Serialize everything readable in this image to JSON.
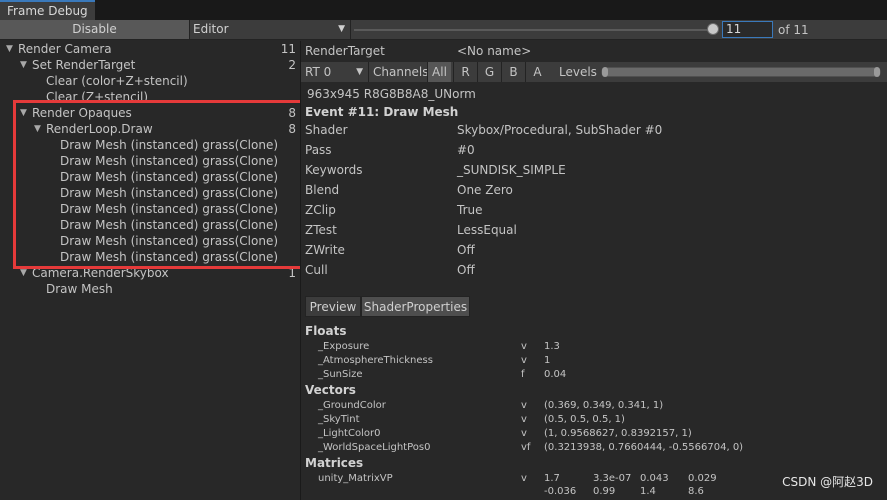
{
  "window": {
    "tab_title": "Frame Debug"
  },
  "toolbar": {
    "disable_label": "Disable",
    "target_value": "Editor",
    "event_index": "11",
    "event_total": "of 11"
  },
  "tree": [
    {
      "label": "Render Camera",
      "count": "11",
      "level": 0,
      "arrow": true
    },
    {
      "label": "Set RenderTarget",
      "count": "2",
      "level": 1,
      "arrow": true
    },
    {
      "label": "Clear (color+Z+stencil)",
      "count": "",
      "level": 2,
      "arrow": false
    },
    {
      "label": "Clear (Z+stencil)",
      "count": "",
      "level": 2,
      "arrow": false
    },
    {
      "label": "Render Opaques",
      "count": "8",
      "level": 1,
      "arrow": true
    },
    {
      "label": "RenderLoop.Draw",
      "count": "8",
      "level": 2,
      "arrow": true
    },
    {
      "label": "Draw Mesh (instanced) grass(Clone)",
      "count": "",
      "level": 3,
      "arrow": false
    },
    {
      "label": "Draw Mesh (instanced) grass(Clone)",
      "count": "",
      "level": 3,
      "arrow": false
    },
    {
      "label": "Draw Mesh (instanced) grass(Clone)",
      "count": "",
      "level": 3,
      "arrow": false
    },
    {
      "label": "Draw Mesh (instanced) grass(Clone)",
      "count": "",
      "level": 3,
      "arrow": false
    },
    {
      "label": "Draw Mesh (instanced) grass(Clone)",
      "count": "",
      "level": 3,
      "arrow": false
    },
    {
      "label": "Draw Mesh (instanced) grass(Clone)",
      "count": "",
      "level": 3,
      "arrow": false
    },
    {
      "label": "Draw Mesh (instanced) grass(Clone)",
      "count": "",
      "level": 3,
      "arrow": false
    },
    {
      "label": "Draw Mesh (instanced) grass(Clone)",
      "count": "",
      "level": 3,
      "arrow": false
    },
    {
      "label": "Camera.RenderSkybox",
      "count": "1",
      "level": 1,
      "arrow": true
    },
    {
      "label": "Draw Mesh",
      "count": "",
      "level": 2,
      "arrow": false
    }
  ],
  "render_target": {
    "label": "RenderTarget",
    "value": "<No name>",
    "rt_select": "RT 0",
    "channels_label": "Channels",
    "channels": [
      "All",
      "R",
      "G",
      "B",
      "A"
    ],
    "active_channel": "All",
    "levels_label": "Levels",
    "format": "963x945 R8G8B8A8_UNorm"
  },
  "event": {
    "title": "Event #11: Draw Mesh",
    "properties": [
      {
        "key": "Shader",
        "value": "Skybox/Procedural, SubShader #0"
      },
      {
        "key": "Pass",
        "value": "#0"
      },
      {
        "key": "Keywords",
        "value": "_SUNDISK_SIMPLE"
      },
      {
        "key": "Blend",
        "value": "One Zero"
      },
      {
        "key": "ZClip",
        "value": "True"
      },
      {
        "key": "ZTest",
        "value": "LessEqual"
      },
      {
        "key": "ZWrite",
        "value": "Off"
      },
      {
        "key": "Cull",
        "value": "Off"
      }
    ]
  },
  "subtabs": {
    "preview": "Preview",
    "shader_properties": "ShaderProperties"
  },
  "shader_props": {
    "floats_label": "Floats",
    "floats": [
      {
        "name": "_Exposure",
        "type": "v",
        "value": "1.3"
      },
      {
        "name": "_AtmosphereThickness",
        "type": "v",
        "value": "1"
      },
      {
        "name": "_SunSize",
        "type": "f",
        "value": "0.04"
      }
    ],
    "vectors_label": "Vectors",
    "vectors": [
      {
        "name": "_GroundColor",
        "type": "v",
        "value": "(0.369, 0.349, 0.341, 1)"
      },
      {
        "name": "_SkyTint",
        "type": "v",
        "value": "(0.5, 0.5, 0.5, 1)"
      },
      {
        "name": "_LightColor0",
        "type": "v",
        "value": "(1, 0.9568627, 0.8392157, 1)"
      },
      {
        "name": "_WorldSpaceLightPos0",
        "type": "vf",
        "value": "(0.3213938, 0.7660444, -0.5566704, 0)"
      }
    ],
    "matrices_label": "Matrices",
    "matrix_name": "unity_MatrixVP",
    "matrix_type": "v",
    "matrix_row1": [
      "1.7",
      "3.3e-07",
      "0.043",
      "0.029"
    ],
    "matrix_row2": [
      "-0.036",
      "0.99",
      "1.4",
      "8.6"
    ]
  },
  "watermark": "CSDN @阿赵3D",
  "colors": {
    "highlight": "#e53a3a",
    "accent": "#3a79bb"
  }
}
